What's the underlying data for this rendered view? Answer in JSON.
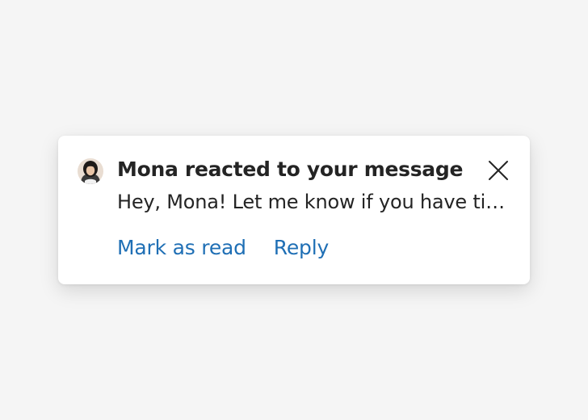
{
  "notification": {
    "title": "Mona reacted to your message",
    "body": "Hey, Mona! Let me know if you have time to chat about the new design proposal.",
    "avatar_icon": "user-avatar",
    "close_icon": "close-icon",
    "actions": [
      {
        "label": "Mark as read"
      },
      {
        "label": "Reply"
      }
    ]
  },
  "colors": {
    "background": "#f5f5f5",
    "card": "#ffffff",
    "text": "#242424",
    "link": "#1f6fb5"
  }
}
